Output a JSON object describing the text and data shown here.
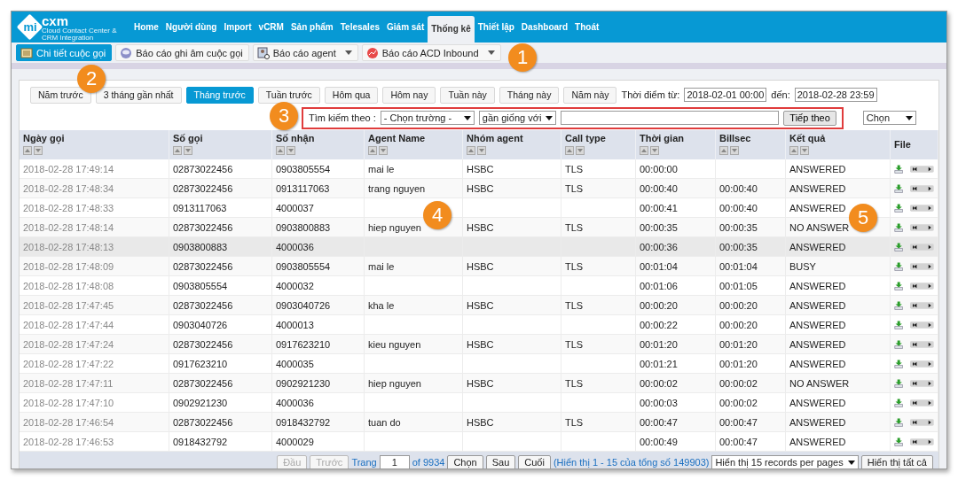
{
  "logo": {
    "part_1": "mi",
    "part_2": "cxm",
    "tagline": "Cloud Contact Center & CRM Integration"
  },
  "nav": [
    {
      "label": "Home",
      "selected": false
    },
    {
      "label": "Người dùng",
      "selected": false
    },
    {
      "label": "Import",
      "selected": false
    },
    {
      "label": "vCRM",
      "selected": false
    },
    {
      "label": "Sản phẩm",
      "selected": false
    },
    {
      "label": "Telesales",
      "selected": false
    },
    {
      "label": "Giám sát",
      "selected": false
    },
    {
      "label": "Thống kê",
      "selected": true
    },
    {
      "label": "Thiết lập",
      "selected": false
    },
    {
      "label": "Dashboard",
      "selected": false
    },
    {
      "label": "Thoát",
      "selected": false
    }
  ],
  "reports": [
    {
      "label": "Chi tiết cuộc gọi",
      "kind": "button",
      "selected": true
    },
    {
      "label": "Báo cáo ghi âm cuộc gọi",
      "kind": "button",
      "selected": false
    },
    {
      "label": "Báo cáo agent",
      "kind": "dropdown",
      "selected": false
    },
    {
      "label": "Báo cáo ACD Inbound",
      "kind": "dropdown",
      "selected": false
    }
  ],
  "ranges": [
    {
      "label": "Năm trước",
      "selected": false
    },
    {
      "label": "3 tháng gần nhất",
      "selected": false
    },
    {
      "label": "Tháng trước",
      "selected": true
    },
    {
      "label": "Tuần trước",
      "selected": false
    },
    {
      "label": "Hôm qua",
      "selected": false
    },
    {
      "label": "Hôm nay",
      "selected": false
    },
    {
      "label": "Tuần này",
      "selected": false
    },
    {
      "label": "Tháng này",
      "selected": false
    },
    {
      "label": "Năm này",
      "selected": false
    }
  ],
  "period": {
    "from_label": "Thời điểm từ:",
    "from": "2018-02-01 00:00",
    "to_label": "đến:",
    "to": "2018-02-28 23:59"
  },
  "search": {
    "highlighted": true,
    "label": "Tìm kiếm theo :",
    "field": "- Chọn trường -",
    "operator": "gần giống với",
    "button": "Tiếp theo"
  },
  "action_select": "Chọn",
  "table": {
    "columns": [
      "Ngày gọi",
      "Số gọi",
      "Số nhận",
      "Agent Name",
      "Nhóm agent",
      "Call type",
      "Thời gian",
      "Billsec",
      "Kết quả",
      "File"
    ],
    "rows": [
      {
        "date": "2018-02-28 17:49:14",
        "caller": "02873022456",
        "callee": "0903805554",
        "agent": "mai le",
        "group": "HSBC",
        "call_type": "TLS",
        "duration": "00:00:00",
        "result": "ANSWERED",
        "selected": false
      },
      {
        "date": "2018-02-28 17:48:34",
        "caller": "02873022456",
        "callee": "0913117063",
        "agent": "trang nguyen",
        "group": "HSBC",
        "call_type": "TLS",
        "duration": "00:00:40",
        "billsec": "00:00:40",
        "result": "ANSWERED",
        "selected": false
      },
      {
        "date": "2018-02-28 17:48:33",
        "caller": "0913117063",
        "callee": "4000037",
        "duration": "00:00:41",
        "billsec": "00:00:40",
        "result": "ANSWERED",
        "selected": false
      },
      {
        "date": "2018-02-28 17:48:14",
        "caller": "02873022456",
        "callee": "0903800883",
        "agent": "hiep nguyen",
        "group": "HSBC",
        "call_type": "TLS",
        "duration": "00:00:35",
        "billsec": "00:00:35",
        "result": "NO ANSWER",
        "selected": false
      },
      {
        "date": "2018-02-28 17:48:13",
        "caller": "0903800883",
        "callee": "4000036",
        "duration": "00:00:36",
        "billsec": "00:00:35",
        "result": "ANSWERED",
        "selected": true
      },
      {
        "date": "2018-02-28 17:48:09",
        "caller": "02873022456",
        "callee": "0903805554",
        "agent": "mai le",
        "group": "HSBC",
        "call_type": "TLS",
        "duration": "00:01:04",
        "billsec": "00:01:04",
        "result": "BUSY",
        "selected": false
      },
      {
        "date": "2018-02-28 17:48:08",
        "caller": "0903805554",
        "callee": "4000032",
        "duration": "00:01:06",
        "billsec": "00:01:05",
        "result": "ANSWERED",
        "selected": false
      },
      {
        "date": "2018-02-28 17:47:45",
        "caller": "02873022456",
        "callee": "0903040726",
        "agent": "kha le",
        "group": "HSBC",
        "call_type": "TLS",
        "duration": "00:00:20",
        "billsec": "00:00:20",
        "result": "ANSWERED",
        "selected": false
      },
      {
        "date": "2018-02-28 17:47:44",
        "caller": "0903040726",
        "callee": "4000013",
        "duration": "00:00:22",
        "billsec": "00:00:20",
        "result": "ANSWERED",
        "selected": false
      },
      {
        "date": "2018-02-28 17:47:24",
        "caller": "02873022456",
        "callee": "0917623210",
        "agent": "kieu nguyen",
        "group": "HSBC",
        "call_type": "TLS",
        "duration": "00:01:20",
        "billsec": "00:01:20",
        "result": "ANSWERED",
        "selected": false
      },
      {
        "date": "2018-02-28 17:47:22",
        "caller": "0917623210",
        "callee": "4000035",
        "duration": "00:01:21",
        "billsec": "00:01:20",
        "result": "ANSWERED",
        "selected": false
      },
      {
        "date": "2018-02-28 17:47:11",
        "caller": "02873022456",
        "callee": "0902921230",
        "agent": "hiep nguyen",
        "group": "HSBC",
        "call_type": "TLS",
        "duration": "00:00:02",
        "billsec": "00:00:02",
        "result": "NO ANSWER",
        "selected": false
      },
      {
        "date": "2018-02-28 17:47:10",
        "caller": "0902921230",
        "callee": "4000036",
        "duration": "00:00:03",
        "billsec": "00:00:02",
        "result": "ANSWERED",
        "selected": false
      },
      {
        "date": "2018-02-28 17:46:54",
        "caller": "02873022456",
        "callee": "0918432792",
        "agent": "tuan do",
        "group": "HSBC",
        "call_type": "TLS",
        "duration": "00:00:47",
        "billsec": "00:00:47",
        "result": "ANSWERED",
        "selected": false
      },
      {
        "date": "2018-02-28 17:46:53",
        "caller": "0918432792",
        "callee": "4000029",
        "duration": "00:00:49",
        "billsec": "00:00:47",
        "result": "ANSWERED",
        "selected": false
      }
    ]
  },
  "pager": {
    "first": "Đầu",
    "prev": "Trước",
    "page_label": "Trang",
    "page": "1",
    "of": "of 9934",
    "go": "Chọn",
    "next": "Sau",
    "last": "Cuối",
    "summary": "(Hiển thị 1 - 15 của tổng số 149903)",
    "per_page": "Hiển thị 15 records per pages",
    "show_all": "Hiển thị tất cả"
  },
  "callouts": [
    "1",
    "2",
    "3",
    "4",
    "5"
  ]
}
